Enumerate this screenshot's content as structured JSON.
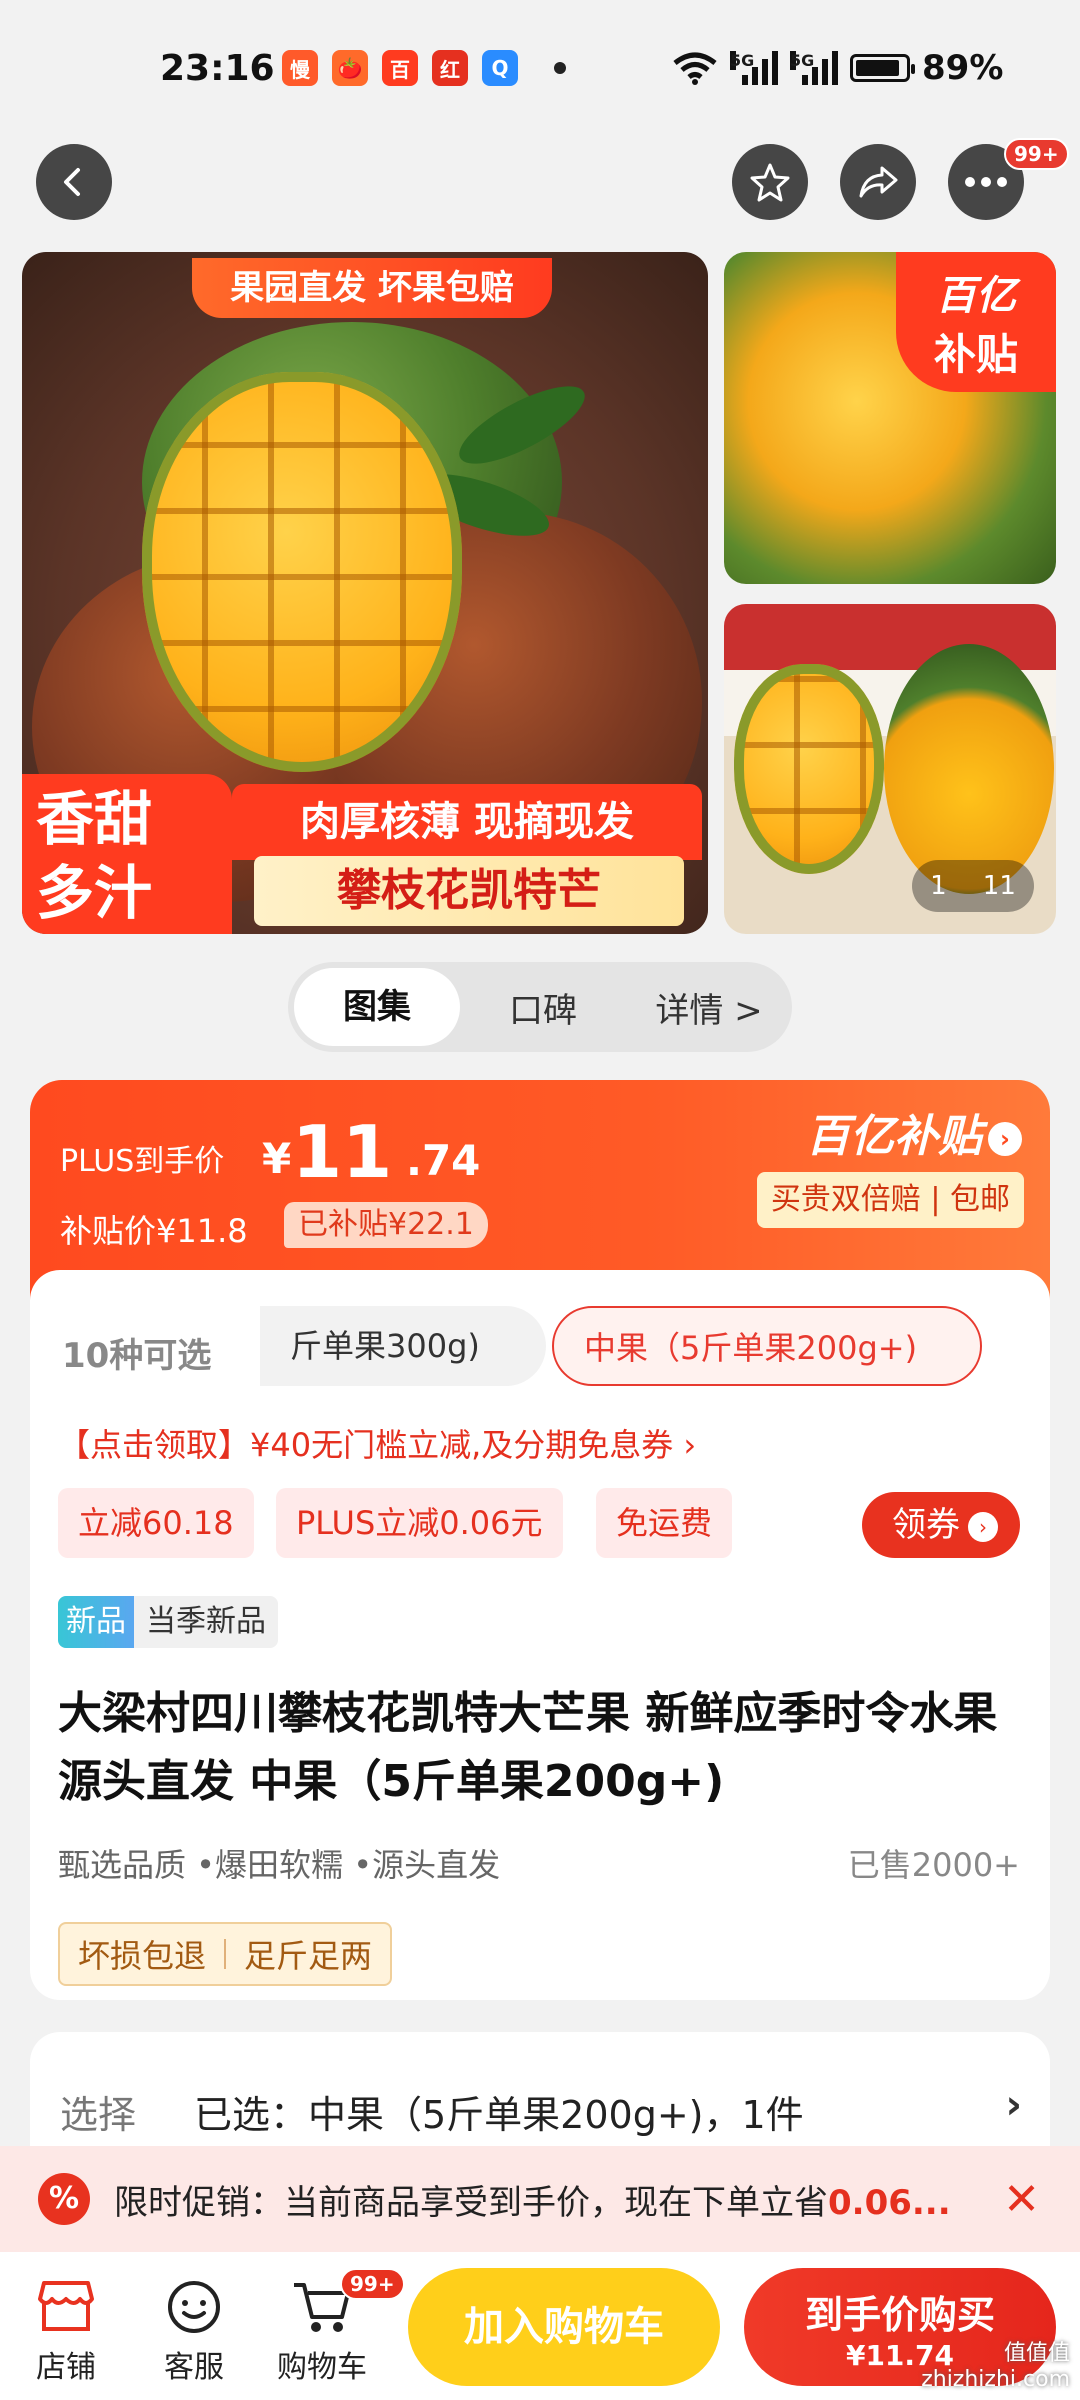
{
  "status_bar": {
    "time": "23:16",
    "battery": "89%",
    "network": "5G",
    "app_icons": [
      {
        "name": "app-icon-1",
        "glyph": "慢",
        "color": "#ff5a2a"
      },
      {
        "name": "app-icon-2",
        "glyph": "🍅",
        "color": "#ff6a2a"
      },
      {
        "name": "app-icon-3",
        "glyph": "百",
        "color": "#ff3b1f"
      },
      {
        "name": "app-icon-4",
        "glyph": "红",
        "color": "#e5301f"
      },
      {
        "name": "app-icon-5",
        "glyph": "Q",
        "color": "#2a8cff"
      }
    ]
  },
  "header": {
    "more_badge": "99+"
  },
  "gallery": {
    "main": {
      "top_ribbon": "果园直发  坏果包赔",
      "sweet_line1": "香甜",
      "sweet_line2": "多汁",
      "slogan": "肉厚核薄  现摘现发",
      "product_name": "攀枝花凯特芒"
    },
    "side_badge_line1": "百亿",
    "side_badge_line2": "补贴",
    "counter_current": "1",
    "counter_total": "11"
  },
  "tabs": [
    {
      "label": "图集",
      "active": true
    },
    {
      "label": "口碑",
      "active": false
    },
    {
      "label": "详情 >",
      "active": false
    }
  ],
  "price_banner": {
    "plus_label": "PLUS到手价",
    "currency": "¥",
    "price_int": "11",
    "price_dec": ".74",
    "sub_price": "补贴价¥11.8",
    "sub_tag": "已补贴¥22.1",
    "yi_logo": "百亿补贴",
    "yi_arrow": "›",
    "yi_sub": "买贵双倍赔 | 包邮"
  },
  "options": {
    "count_label": "10种可选",
    "chips": [
      {
        "label": "斤单果300g)",
        "selected": false
      },
      {
        "label": "中果（5斤单果200g+)",
        "selected": true
      }
    ]
  },
  "coupon_line": "【点击领取】¥40无门槛立减,及分期免息券 ›",
  "promo_tags": [
    "立减60.18",
    "PLUS立减0.06元",
    "免运费"
  ],
  "claim_button": "领券",
  "new_badge": {
    "a": "新品",
    "b": "当季新品"
  },
  "product_title": "大梁村四川攀枝花凯特大芒果 新鲜应季时令水果 源头直发 中果（5斤单果200g+)",
  "features": "甄选品质 •爆田软糯 •源头直发",
  "sold": "已售2000+",
  "guarantees": [
    "坏损包退",
    "足斤足两"
  ],
  "select": {
    "label": "选择",
    "value": "已选：中果（5斤单果200g+)，1件",
    "arrow": "›"
  },
  "notice": {
    "icon": "%",
    "text": "限时促销：当前商品享受到手价，现在下单立省",
    "highlight": "0.06...",
    "close": "✕"
  },
  "bottom_nav": [
    {
      "label": "店铺"
    },
    {
      "label": "客服"
    },
    {
      "label": "购物车"
    }
  ],
  "cart_badge": "99+",
  "add_to_cart": "加入购物车",
  "buy_now": {
    "line1": "到手价购买",
    "line2": "¥11.74"
  },
  "watermark": {
    "line1": "值值值",
    "line2": "zhizhizhi.com"
  }
}
